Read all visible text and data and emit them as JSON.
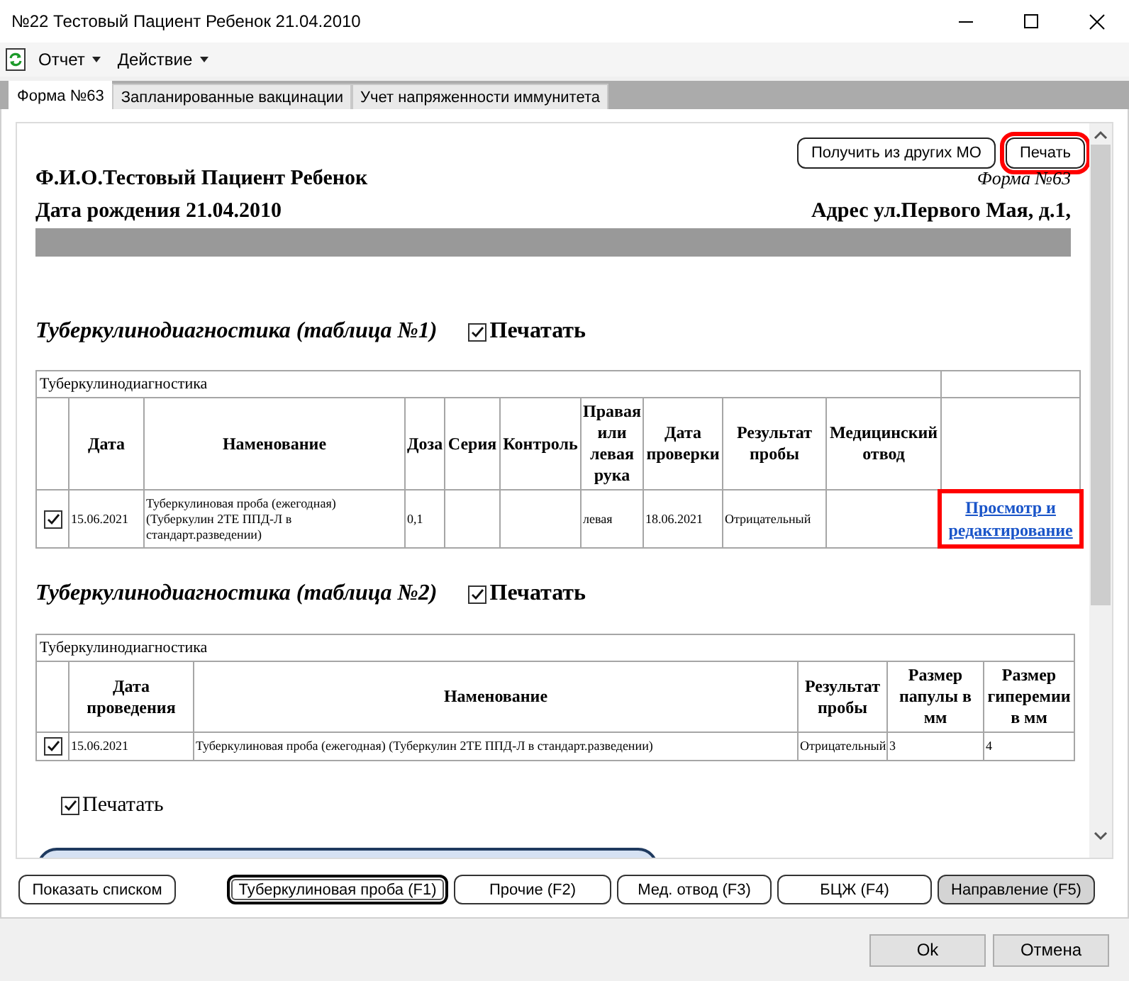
{
  "window": {
    "title": "№22 Тестовый Пациент Ребенок 21.04.2010"
  },
  "menu": [
    {
      "label": "Отчет"
    },
    {
      "label": "Действие"
    }
  ],
  "tabs": [
    {
      "label": "Форма №63",
      "selected": true
    },
    {
      "label": "Запланированные вакцинации",
      "selected": false
    },
    {
      "label": "Учет напряженности иммунитета",
      "selected": false
    }
  ],
  "document": {
    "buttons": [
      {
        "label": "Получить из других МО",
        "highlighted": false
      },
      {
        "label": "Печать",
        "highlighted": true
      }
    ],
    "patient_name": "Ф.И.О.Тестовый Пациент Ребенок",
    "form_label": "Форма №63",
    "birth_date": "Дата рождения 21.04.2010",
    "address": "Адрес ул.Первого Мая, д.1,",
    "sections": [
      {
        "title": "Туберкулинодиагностика (таблица №1)",
        "print_label": "Печатать",
        "print_checked": true,
        "table": {
          "caption": "Туберкулинодиагностика",
          "columns": [
            "Дата",
            "Наменование",
            "Доза",
            "Серия",
            "Контроль",
            "Правая или левая рука",
            "Дата проверки",
            "Результат пробы",
            "Медицинский отвод"
          ],
          "rows": [
            {
              "checked": true,
              "cells": [
                "15.06.2021",
                "Туберкулиновая проба (ежегодная) (Туберкулин 2ТЕ ППД-Л в стандарт.разведении)",
                "0,1",
                null,
                null,
                "левая",
                "18.06.2021",
                "Отрицательный",
                null
              ],
              "link": {
                "label": "Просмотр и редактирование",
                "highlighted": true
              }
            }
          ]
        }
      },
      {
        "title": "Туберкулинодиагностика (таблица №2)",
        "print_label": "Печатать",
        "print_checked": true,
        "table": {
          "caption": "Туберкулинодиагностика",
          "columns": [
            "Дата проведения",
            "Наменование",
            "Результат пробы",
            "Размер папулы в мм",
            "Размер гиперемии в мм"
          ],
          "rows": [
            {
              "checked": true,
              "cells": [
                "15.06.2021",
                "Туберкулиновая проба (ежегодная) (Туберкулин 2ТЕ ППД-Л в стандарт.разведении)",
                "Отрицательный",
                "3",
                "4"
              ]
            }
          ]
        }
      }
    ],
    "print_option": {
      "label": "Печатать",
      "checked": true
    }
  },
  "bottom_buttons": [
    {
      "label": "Показать списком",
      "selected": false,
      "pressed": false
    },
    {
      "label": "Туберкулиновая проба (F1)",
      "selected": true,
      "pressed": false
    },
    {
      "label": "Прочие (F2)",
      "selected": false,
      "pressed": false
    },
    {
      "label": "Мед. отвод (F3)",
      "selected": false,
      "pressed": false
    },
    {
      "label": "БЦЖ (F4)",
      "selected": false,
      "pressed": false
    },
    {
      "label": "Направление (F5)",
      "selected": false,
      "pressed": true
    }
  ],
  "dialog_buttons": [
    {
      "label": "Ok"
    },
    {
      "label": "Отмена"
    }
  ]
}
